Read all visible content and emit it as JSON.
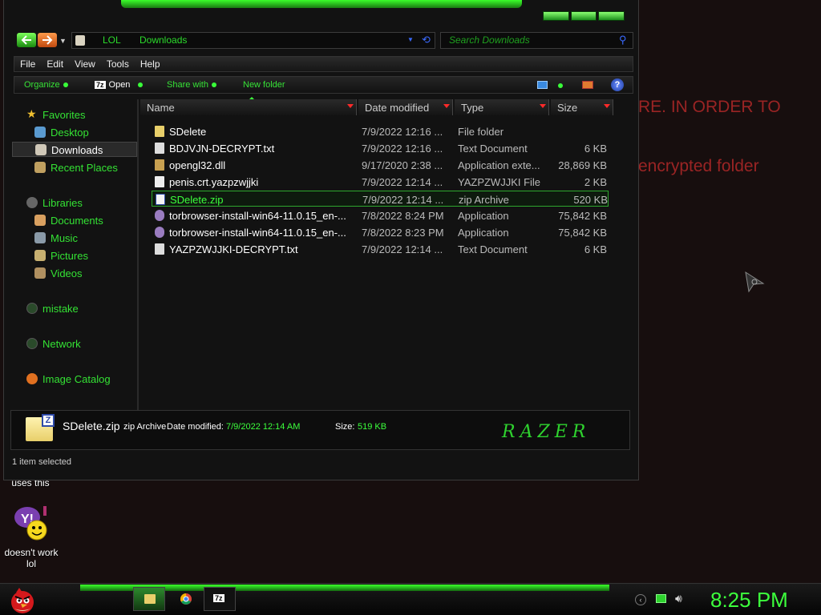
{
  "desktop": {
    "overlay_text_1": "RE. IN ORDER TO",
    "overlay_text_2": "encrypted folder",
    "label_uses_this": "uses this",
    "label_doesnt_work": "doesn't work lol"
  },
  "address": {
    "crumbs": [
      "LOL",
      "Downloads"
    ],
    "search_placeholder": "Search Downloads"
  },
  "menu": [
    "File",
    "Edit",
    "View",
    "Tools",
    "Help"
  ],
  "toolbar": {
    "organize": "Organize",
    "open": "Open",
    "share_with": "Share with",
    "new_folder": "New folder"
  },
  "sidebar": {
    "favorites": "Favorites",
    "desktop": "Desktop",
    "downloads": "Downloads",
    "recent": "Recent Places",
    "libraries": "Libraries",
    "documents": "Documents",
    "music": "Music",
    "pictures": "Pictures",
    "videos": "Videos",
    "mistake": "mistake",
    "network": "Network",
    "image_catalog": "Image Catalog"
  },
  "columns": {
    "name": "Name",
    "date": "Date modified",
    "type": "Type",
    "size": "Size"
  },
  "files": [
    {
      "name": "SDelete",
      "date": "7/9/2022 12:16 ...",
      "type": "File folder",
      "size": "",
      "icon": "folder-icon",
      "color": "#e8cf6a"
    },
    {
      "name": "BDJVJN-DECRYPT.txt",
      "date": "7/9/2022 12:16 ...",
      "type": "Text Document",
      "size": "6 KB",
      "icon": "text-file-icon",
      "color": "#dddddd"
    },
    {
      "name": "opengl32.dll",
      "date": "9/17/2020 2:38 ...",
      "type": "Application exte...",
      "size": "28,869 KB",
      "icon": "dll-icon",
      "color": "#c8a050"
    },
    {
      "name": "penis.crt.yazpzwjjki",
      "date": "7/9/2022 12:14 ...",
      "type": "YAZPZWJJKI File",
      "size": "2 KB",
      "icon": "file-icon",
      "color": "#eeeeee"
    },
    {
      "name": "SDelete.zip",
      "date": "7/9/2022 12:14 ...",
      "type": "zip Archive",
      "size": "520 KB",
      "icon": "zip-icon",
      "color": "#f4f4f4"
    },
    {
      "name": "torbrowser-install-win64-11.0.15_en-...",
      "date": "7/8/2022 8:24 PM",
      "type": "Application",
      "size": "75,842 KB",
      "icon": "tor-icon",
      "color": "#9a7cc0"
    },
    {
      "name": "torbrowser-install-win64-11.0.15_en-...",
      "date": "7/8/2022 8:23 PM",
      "type": "Application",
      "size": "75,842 KB",
      "icon": "tor-icon",
      "color": "#9a7cc0"
    },
    {
      "name": "YAZPZWJJKI-DECRYPT.txt",
      "date": "7/9/2022 12:14 ...",
      "type": "Text Document",
      "size": "6 KB",
      "icon": "text-file-icon",
      "color": "#dddddd"
    }
  ],
  "selected_index": 4,
  "details": {
    "name": "SDelete.zip",
    "type": "zip Archive",
    "date_label": "Date modified:",
    "date_value": "7/9/2022 12:14 AM",
    "size_label": "Size:",
    "size_value": "519 KB",
    "brand": "RAZER"
  },
  "status": "1 item selected",
  "clock": "8:25 PM"
}
